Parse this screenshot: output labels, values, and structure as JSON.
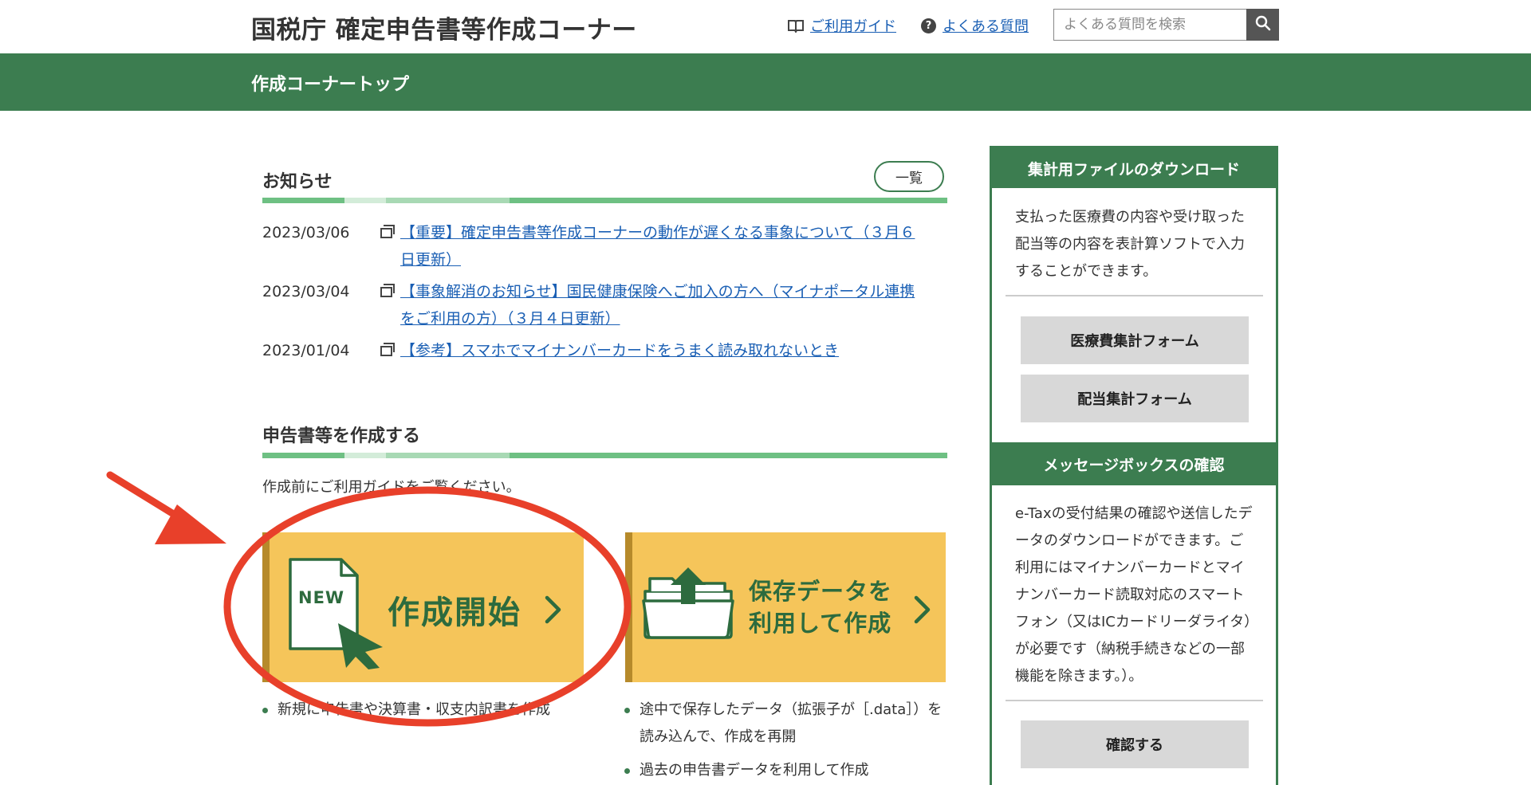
{
  "header": {
    "site_title": "国税庁 確定申告書等作成コーナー",
    "guide_link": "ご利用ガイド",
    "faq_link": "よくある質問",
    "search_placeholder": "よくある質問を検索"
  },
  "nav": {
    "title": "作成コーナートップ"
  },
  "news": {
    "title": "お知らせ",
    "list_button": "一覧",
    "items": [
      {
        "date": "2023/03/06",
        "text": "【重要】確定申告書等作成コーナーの動作が遅くなる事象について（３月６日更新）"
      },
      {
        "date": "2023/03/04",
        "text": "【事象解消のお知らせ】国民健康保険へご加入の方へ（マイナポータル連携をご利用の方）（３月４日更新）"
      },
      {
        "date": "2023/01/04",
        "text": "【参考】スマホでマイナンバーカードをうまく読み取れないとき"
      }
    ]
  },
  "create": {
    "title": "申告書等を作成する",
    "note": "作成前にご利用ガイドをご覧ください。",
    "start_button": {
      "badge": "NEW",
      "label": "作成開始"
    },
    "resume_button": {
      "line1": "保存データを",
      "line2": "利用して作成"
    },
    "start_bullets": [
      "新規に申告書や決算書・収支内訳書を作成"
    ],
    "resume_bullets": [
      "途中で保存したデータ（拡張子が［.data］）を読み込んで、作成を再開",
      "過去の申告書データを利用して作成"
    ]
  },
  "sidebar": {
    "download": {
      "title": "集計用ファイルのダウンロード",
      "description": "支払った医療費の内容や受け取った配当等の内容を表計算ソフトで入力することができます。",
      "buttons": [
        "医療費集計フォーム",
        "配当集計フォーム"
      ]
    },
    "messagebox": {
      "title": "メッセージボックスの確認",
      "description": "e-Taxの受付結果の確認や送信したデータのダウンロードができます。ご利用にはマイナンバーカードとマイナンバーカード読取対応のスマートフォン（又はICカードリーダライタ）が必要です（納税手続きなどの一部機能を除きます。）。",
      "button": "確認する"
    }
  },
  "colors": {
    "brand_green": "#3c7d50",
    "button_yellow": "#f5c55a",
    "link_blue": "#1a5fb4",
    "annotation_red": "#e8402a"
  }
}
